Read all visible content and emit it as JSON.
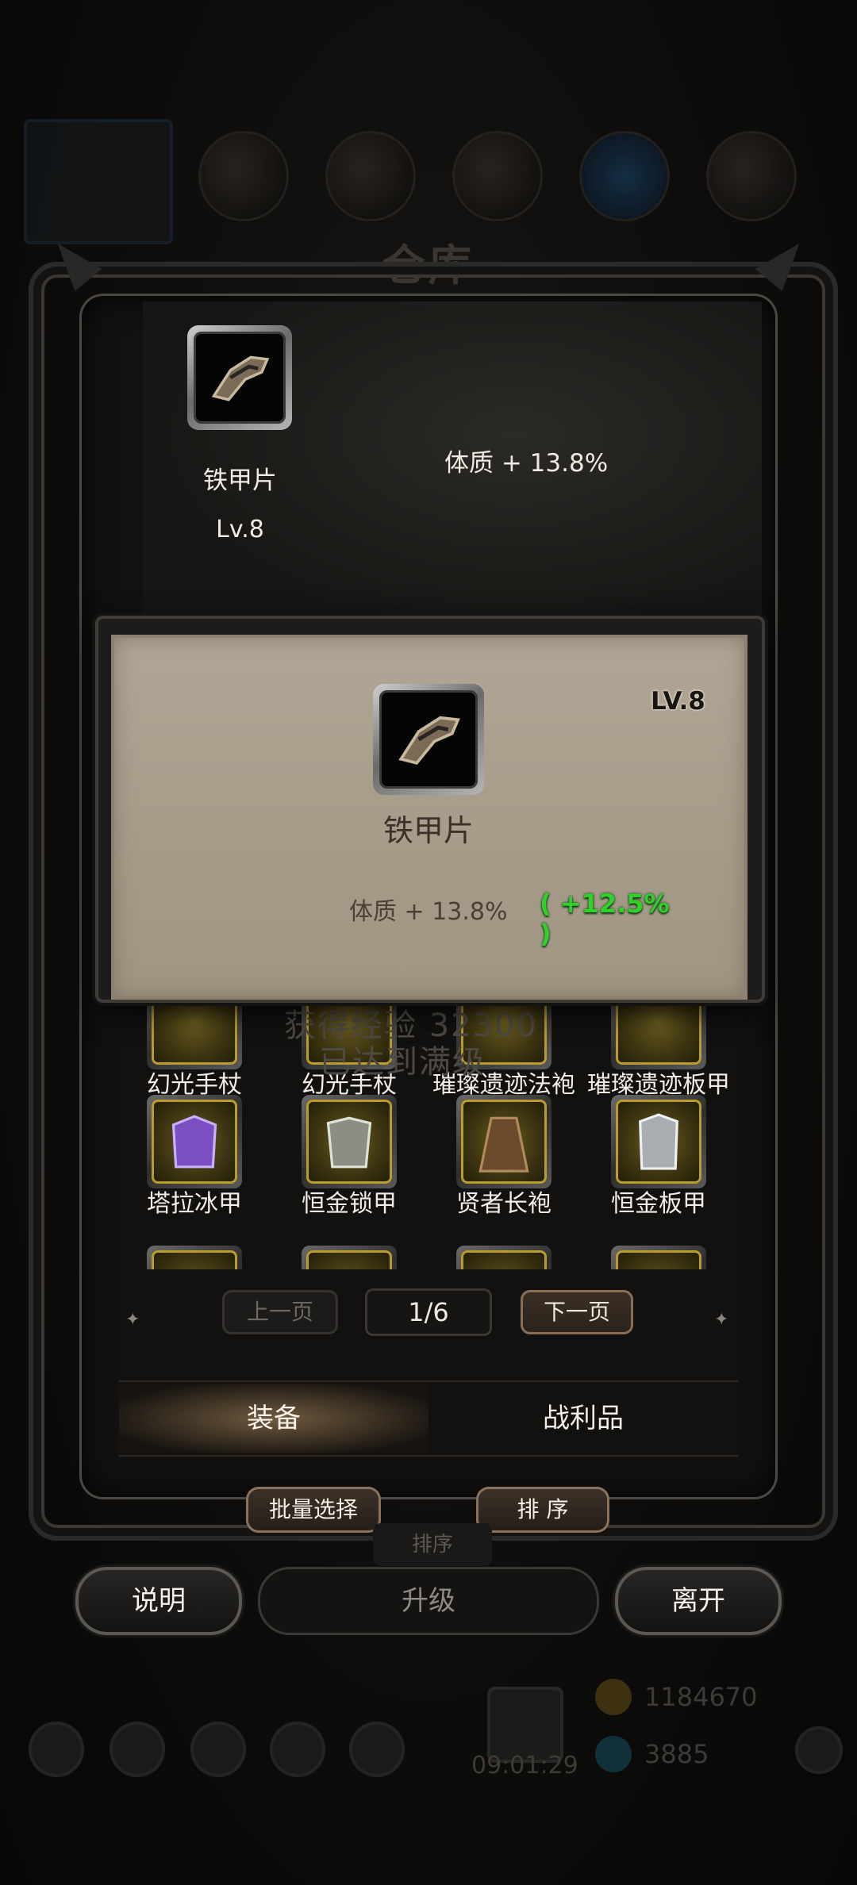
{
  "warehouse_title": "仓库",
  "top_preview": {
    "item_name": "铁甲片",
    "item_level": "Lv.8",
    "stat": "体质 + 13.8%",
    "icon": "iron-armor-shard-icon"
  },
  "popup": {
    "level": "LV.8",
    "item_name": "铁甲片",
    "stat": "体质 + 13.8%",
    "bonus": "( +12.5% )",
    "bonus_color": "#2fd12a",
    "icon": "iron-armor-shard-icon"
  },
  "overlay_text": {
    "line1": "获得经验 32300",
    "line2": "已达到满级"
  },
  "grid": {
    "row1": [
      "幻光手杖",
      "幻光手杖",
      "璀璨遗迹法袍",
      "璀璨遗迹板甲"
    ],
    "row2": [
      "塔拉冰甲",
      "恒金锁甲",
      "贤者长袍",
      "恒金板甲"
    ]
  },
  "pager": {
    "prev_label": "上一页",
    "page_indicator": "1/6",
    "next_label": "下一页"
  },
  "tabs": {
    "equipment": "装备",
    "loot": "战利品"
  },
  "actions": {
    "batch_select": "批量选择",
    "sort": "排 序",
    "sort_ghost": "排序"
  },
  "bottom": {
    "help": "说明",
    "upgrade": "升级",
    "leave": "离开"
  },
  "footer": {
    "gold": "1184670",
    "gems": "3885",
    "timer": "09:01:29"
  },
  "colors": {
    "accent_gold": "#b99c2a",
    "popup_bg": "#a89c8b",
    "bonus_green": "#2fd12a"
  }
}
